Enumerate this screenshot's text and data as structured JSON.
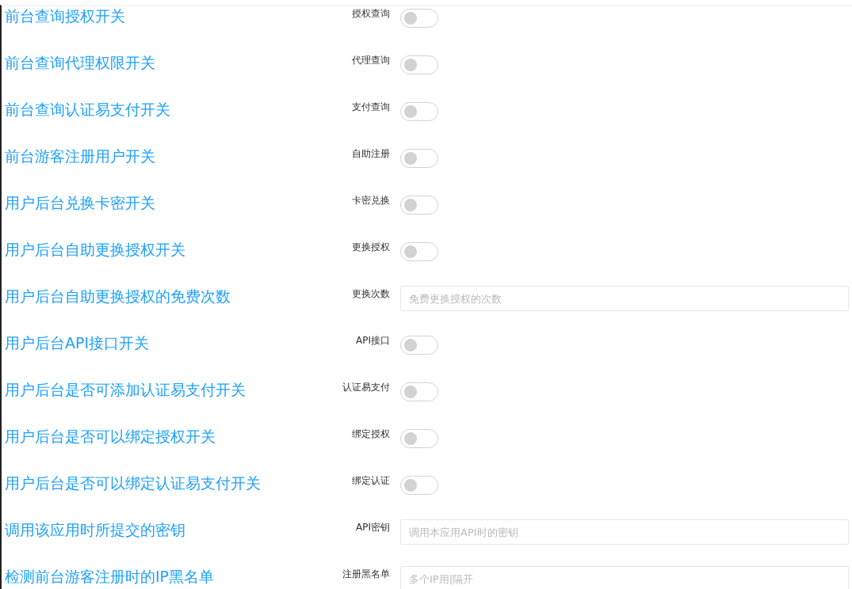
{
  "settings": [
    {
      "heading": "前台查询授权开关",
      "label": "授权查询",
      "kind": "toggle",
      "on": false
    },
    {
      "heading": "前台查询代理权限开关",
      "label": "代理查询",
      "kind": "toggle",
      "on": false
    },
    {
      "heading": "前台查询认证易支付开关",
      "label": "支付查询",
      "kind": "toggle",
      "on": false
    },
    {
      "heading": "前台游客注册用户开关",
      "label": "自助注册",
      "kind": "toggle",
      "on": false
    },
    {
      "heading": "用户后台兑换卡密开关",
      "label": "卡密兑换",
      "kind": "toggle",
      "on": false
    },
    {
      "heading": "用户后台自助更换授权开关",
      "label": "更换授权",
      "kind": "toggle",
      "on": false
    },
    {
      "heading": "用户后台自助更换授权的免费次数",
      "label": "更换次数",
      "kind": "input",
      "placeholder": "免费更换授权的次数"
    },
    {
      "heading": "用户后台API接口开关",
      "label": "API接口",
      "kind": "toggle",
      "on": false
    },
    {
      "heading": "用户后台是否可添加认证易支付开关",
      "label": "认证易支付",
      "kind": "toggle",
      "on": false
    },
    {
      "heading": "用户后台是否可以绑定授权开关",
      "label": "绑定授权",
      "kind": "toggle",
      "on": false
    },
    {
      "heading": "用户后台是否可以绑定认证易支付开关",
      "label": "绑定认证",
      "kind": "toggle",
      "on": false
    },
    {
      "heading": "调用该应用时所提交的密钥",
      "label": "API密钥",
      "kind": "input",
      "placeholder": "调用本应用API时的密钥"
    },
    {
      "heading": "检测前台游客注册时的IP黑名单",
      "label": "注册黑名单",
      "kind": "input",
      "placeholder": "多个IP用|隔开"
    }
  ]
}
